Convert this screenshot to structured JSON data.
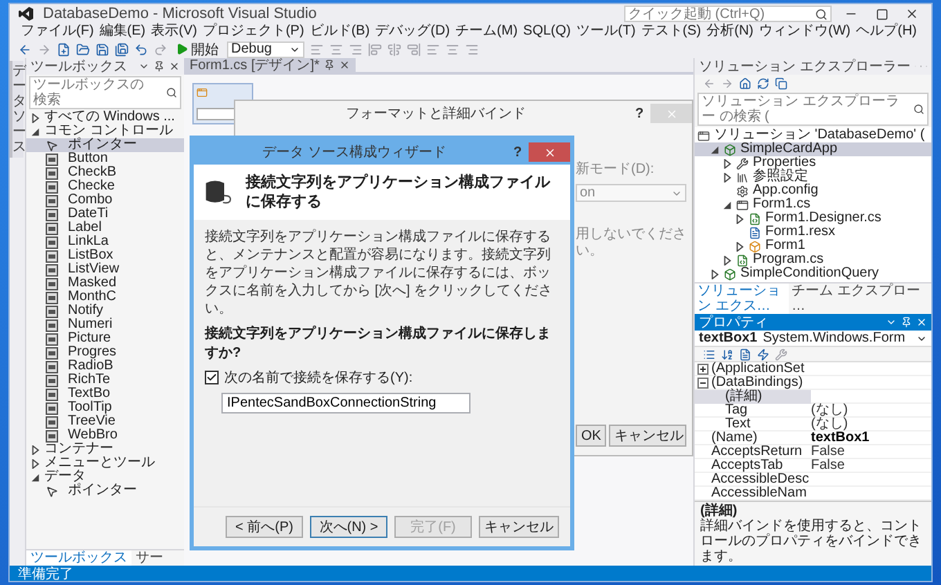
{
  "window": {
    "title": "DatabaseDemo - Microsoft Visual Studio",
    "quick_launch": {
      "placeholder": "クイック起動 (Ctrl+Q)"
    }
  },
  "menu": [
    "ファイル(F)",
    "編集(E)",
    "表示(V)",
    "プロジェクト(P)",
    "ビルド(B)",
    "デバッグ(D)",
    "チーム(M)",
    "SQL(Q)",
    "ツール(T)",
    "テスト(S)",
    "分析(N)",
    "ウィンドウ(W)",
    "ヘルプ(H)"
  ],
  "toolbar": {
    "start": "開始",
    "configuration": "Debug"
  },
  "data_sources_tab": "データソース",
  "toolbox": {
    "title": "ツールボックス",
    "search": {
      "placeholder": "ツールボックスの検索"
    },
    "groups": [
      {
        "label": "すべての Windows ...",
        "expanded": false
      },
      {
        "label": "コモン コントロール",
        "expanded": true,
        "items": [
          {
            "label": "ポインター",
            "kind": "pointer",
            "selected": true
          },
          {
            "label": "Button",
            "kind": "control",
            "selected": false
          },
          {
            "label": "CheckB",
            "kind": "control",
            "selected": false
          },
          {
            "label": "Checke",
            "kind": "control",
            "selected": false
          },
          {
            "label": "Combo",
            "kind": "control",
            "selected": false
          },
          {
            "label": "DateTi",
            "kind": "control",
            "selected": false
          },
          {
            "label": "Label",
            "kind": "control",
            "selected": false
          },
          {
            "label": "LinkLa",
            "kind": "control",
            "selected": false
          },
          {
            "label": "ListBox",
            "kind": "control",
            "selected": false
          },
          {
            "label": "ListView",
            "kind": "control",
            "selected": false
          },
          {
            "label": "Masked",
            "kind": "control",
            "selected": false
          },
          {
            "label": "MonthC",
            "kind": "control",
            "selected": false
          },
          {
            "label": "Notify",
            "kind": "control",
            "selected": false
          },
          {
            "label": "Numeri",
            "kind": "control",
            "selected": false
          },
          {
            "label": "Picture",
            "kind": "control",
            "selected": false
          },
          {
            "label": "Progres",
            "kind": "control",
            "selected": false
          },
          {
            "label": "RadioB",
            "kind": "control",
            "selected": false
          },
          {
            "label": "RichTe",
            "kind": "control",
            "selected": false
          },
          {
            "label": "TextBo",
            "kind": "control",
            "selected": false
          },
          {
            "label": "ToolTip",
            "kind": "control",
            "selected": false
          },
          {
            "label": "TreeVie",
            "kind": "control",
            "selected": false
          },
          {
            "label": "WebBro",
            "kind": "control",
            "selected": false
          }
        ]
      },
      {
        "label": "コンテナー",
        "expanded": false
      },
      {
        "label": "メニューとツール",
        "expanded": false
      },
      {
        "label": "データ",
        "expanded": true,
        "items": [
          {
            "label": "ポインター",
            "kind": "pointer",
            "selected": false
          }
        ]
      }
    ],
    "tabs": [
      {
        "label": "ツールボックス",
        "selected": true
      },
      {
        "label": "サー",
        "selected": false
      }
    ]
  },
  "document_tabs": [
    {
      "label": "Form1.cs [デザイン]*",
      "selected": true
    }
  ],
  "format_dialog": {
    "title": "フォーマットと詳細バインド",
    "help": "?",
    "update_mode_label": "新モード(D):",
    "update_mode_value": "on",
    "note": "用しないでください。",
    "buttons": [
      "OK",
      "キャンセル"
    ]
  },
  "wizard": {
    "title": "データ ソース構成ウィザード",
    "help": "?",
    "heading": "接続文字列をアプリケーション構成ファイルに保存する",
    "description": "接続文字列をアプリケーション構成ファイルに保存すると、メンテナンスと配置が容易になります。接続文字列をアプリケーション構成ファイルに保存するには、ボックスに名前を入力してから [次へ] をクリックしてください。",
    "question": "接続文字列をアプリケーション構成ファイルに保存しますか?",
    "save_checkbox": {
      "label": "次の名前で接続を保存する(Y):",
      "checked": true
    },
    "connection_name": {
      "value": "IPentecSandBoxConnectionString"
    },
    "buttons": [
      {
        "label": "< 前へ(P)",
        "disabled": false,
        "focused": false
      },
      {
        "label": "次へ(N) >",
        "disabled": false,
        "focused": true
      },
      {
        "label": "完了(F)",
        "disabled": true,
        "focused": false
      },
      {
        "label": "キャンセル",
        "disabled": false,
        "focused": false
      }
    ]
  },
  "solution_explorer": {
    "title": "ソリューション エクスプローラー",
    "search": {
      "placeholder": "ソリューション エクスプローラー の検索 ("
    },
    "tree": [
      {
        "label": "ソリューション 'DatabaseDemo' (",
        "kind": "solution",
        "expanded": true,
        "selected": false,
        "children": [
          {
            "label": "SimpleCardApp",
            "kind": "project",
            "expanded": true,
            "selected": true,
            "children": [
              {
                "label": "Properties",
                "kind": "properties",
                "expanded": false,
                "selected": false
              },
              {
                "label": "参照設定",
                "kind": "references",
                "expanded": false,
                "selected": false
              },
              {
                "label": "App.config",
                "kind": "config",
                "selected": false
              },
              {
                "label": "Form1.cs",
                "kind": "form",
                "expanded": true,
                "selected": false,
                "children": [
                  {
                    "label": "Form1.Designer.cs",
                    "kind": "code",
                    "expanded": false,
                    "selected": false
                  },
                  {
                    "label": "Form1.resx",
                    "kind": "resource",
                    "selected": false
                  },
                  {
                    "label": "Form1",
                    "kind": "class",
                    "expanded": false,
                    "selected": false
                  }
                ]
              },
              {
                "label": "Program.cs",
                "kind": "code",
                "expanded": false,
                "selected": false
              }
            ]
          },
          {
            "label": "SimpleConditionQuery",
            "kind": "project",
            "expanded": false,
            "selected": false
          }
        ]
      }
    ],
    "tabs": [
      {
        "label": "ソリューション エクス…",
        "selected": true
      },
      {
        "label": "チーム エクスプロー…",
        "selected": false
      }
    ]
  },
  "properties": {
    "title": "プロパティ",
    "object": {
      "name": "textBox1",
      "type": "System.Windows.Form"
    },
    "rows": [
      {
        "kind": "category",
        "name": "(ApplicationSet",
        "expanded": false
      },
      {
        "kind": "category",
        "name": "(DataBindings)",
        "expanded": true,
        "children": [
          {
            "kind": "property",
            "name": "(詳細)",
            "selected": true
          },
          {
            "kind": "property",
            "name": "Tag",
            "value": "(なし)",
            "selected": false,
            "modified": false
          },
          {
            "kind": "property",
            "name": "Text",
            "value": "(なし)",
            "selected": false,
            "modified": false
          }
        ]
      },
      {
        "kind": "property",
        "name": "(Name)",
        "value": "textBox1",
        "selected": false,
        "modified": true
      },
      {
        "kind": "property",
        "name": "AcceptsReturn",
        "value": "False",
        "selected": false,
        "modified": false
      },
      {
        "kind": "property",
        "name": "AcceptsTab",
        "value": "False",
        "selected": false,
        "modified": false
      },
      {
        "kind": "property",
        "name": "AccessibleDesc",
        "selected": false
      },
      {
        "kind": "property",
        "name": "AccessibleNam",
        "selected": false
      }
    ],
    "description": {
      "title": "(詳細)",
      "text": "詳細バインドを使用すると、コントロールのプロパティをバインドできます。"
    }
  },
  "status_bar": {
    "text": "準備完了"
  }
}
